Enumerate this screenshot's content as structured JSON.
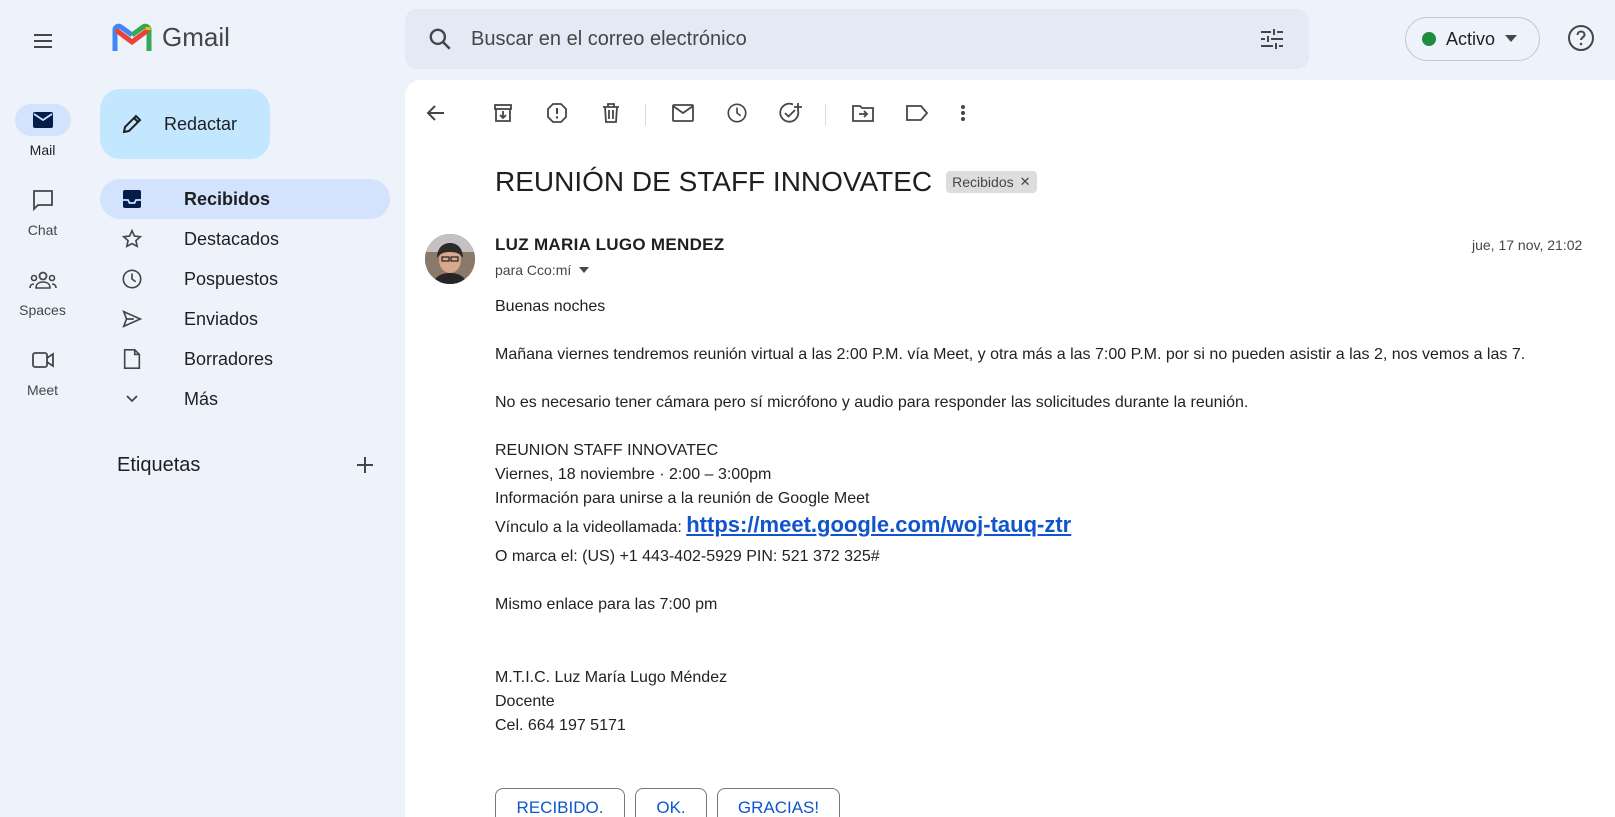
{
  "app": {
    "name": "Gmail"
  },
  "rail": {
    "items": [
      {
        "label": "Mail",
        "icon": "mail-icon",
        "active": true
      },
      {
        "label": "Chat",
        "icon": "chat-icon",
        "active": false
      },
      {
        "label": "Spaces",
        "icon": "spaces-icon",
        "active": false
      },
      {
        "label": "Meet",
        "icon": "meet-icon",
        "active": false
      }
    ]
  },
  "compose": {
    "label": "Redactar"
  },
  "nav": {
    "items": [
      {
        "label": "Recibidos",
        "icon": "inbox-icon",
        "active": true
      },
      {
        "label": "Destacados",
        "icon": "star-icon",
        "active": false
      },
      {
        "label": "Pospuestos",
        "icon": "clock-icon",
        "active": false
      },
      {
        "label": "Enviados",
        "icon": "send-icon",
        "active": false
      },
      {
        "label": "Borradores",
        "icon": "draft-icon",
        "active": false
      },
      {
        "label": "Más",
        "icon": "chevron-down-icon",
        "active": false
      }
    ],
    "labels_heading": "Etiquetas"
  },
  "search": {
    "placeholder": "Buscar en el correo electrónico"
  },
  "status": {
    "label": "Activo",
    "color": "#1e8e3e"
  },
  "email": {
    "subject": "REUNIÓN DE STAFF INNOVATEC",
    "label_chip": "Recibidos",
    "sender": "LUZ MARIA LUGO MENDEZ",
    "recipient": "para Cco:mí",
    "date": "jue, 17 nov, 21:02",
    "greeting": "Buenas noches",
    "paragraph1": "Mañana viernes tendremos reunión virtual a las 2:00 P.M. vía Meet, y otra más a las 7:00 P.M. por si no pueden asistir a las 2, nos vemos a las 7.",
    "paragraph2": "No es necesario tener cámara pero sí micrófono y audio para responder las solicitudes durante la reunión.",
    "event_title": "REUNION STAFF INNOVATEC",
    "event_time": "Viernes, 18 noviembre · 2:00 – 3:00pm",
    "join_info": "Información para unirse a la reunión de Google Meet",
    "link_prefix": "Vínculo a la videollamada: ",
    "link": "https://meet.google.com/woj-tauq-ztr",
    "dial_in": "O marca el: (US) +1 443-402-5929 PIN: 521 372 325#",
    "same_link": "Mismo enlace para las 7:00 pm",
    "signature_name": "M.T.I.C. Luz María Lugo Méndez",
    "signature_role": "Docente",
    "signature_phone": "Cel. 664 197 5171"
  },
  "smart_replies": [
    "RECIBIDO.",
    "OK.",
    "GRACIAS!"
  ],
  "colors": {
    "accent": "#0b57d0",
    "compose_bg": "#c2e7ff",
    "active_nav": "#d3e3fd",
    "link": "#1155cc"
  }
}
